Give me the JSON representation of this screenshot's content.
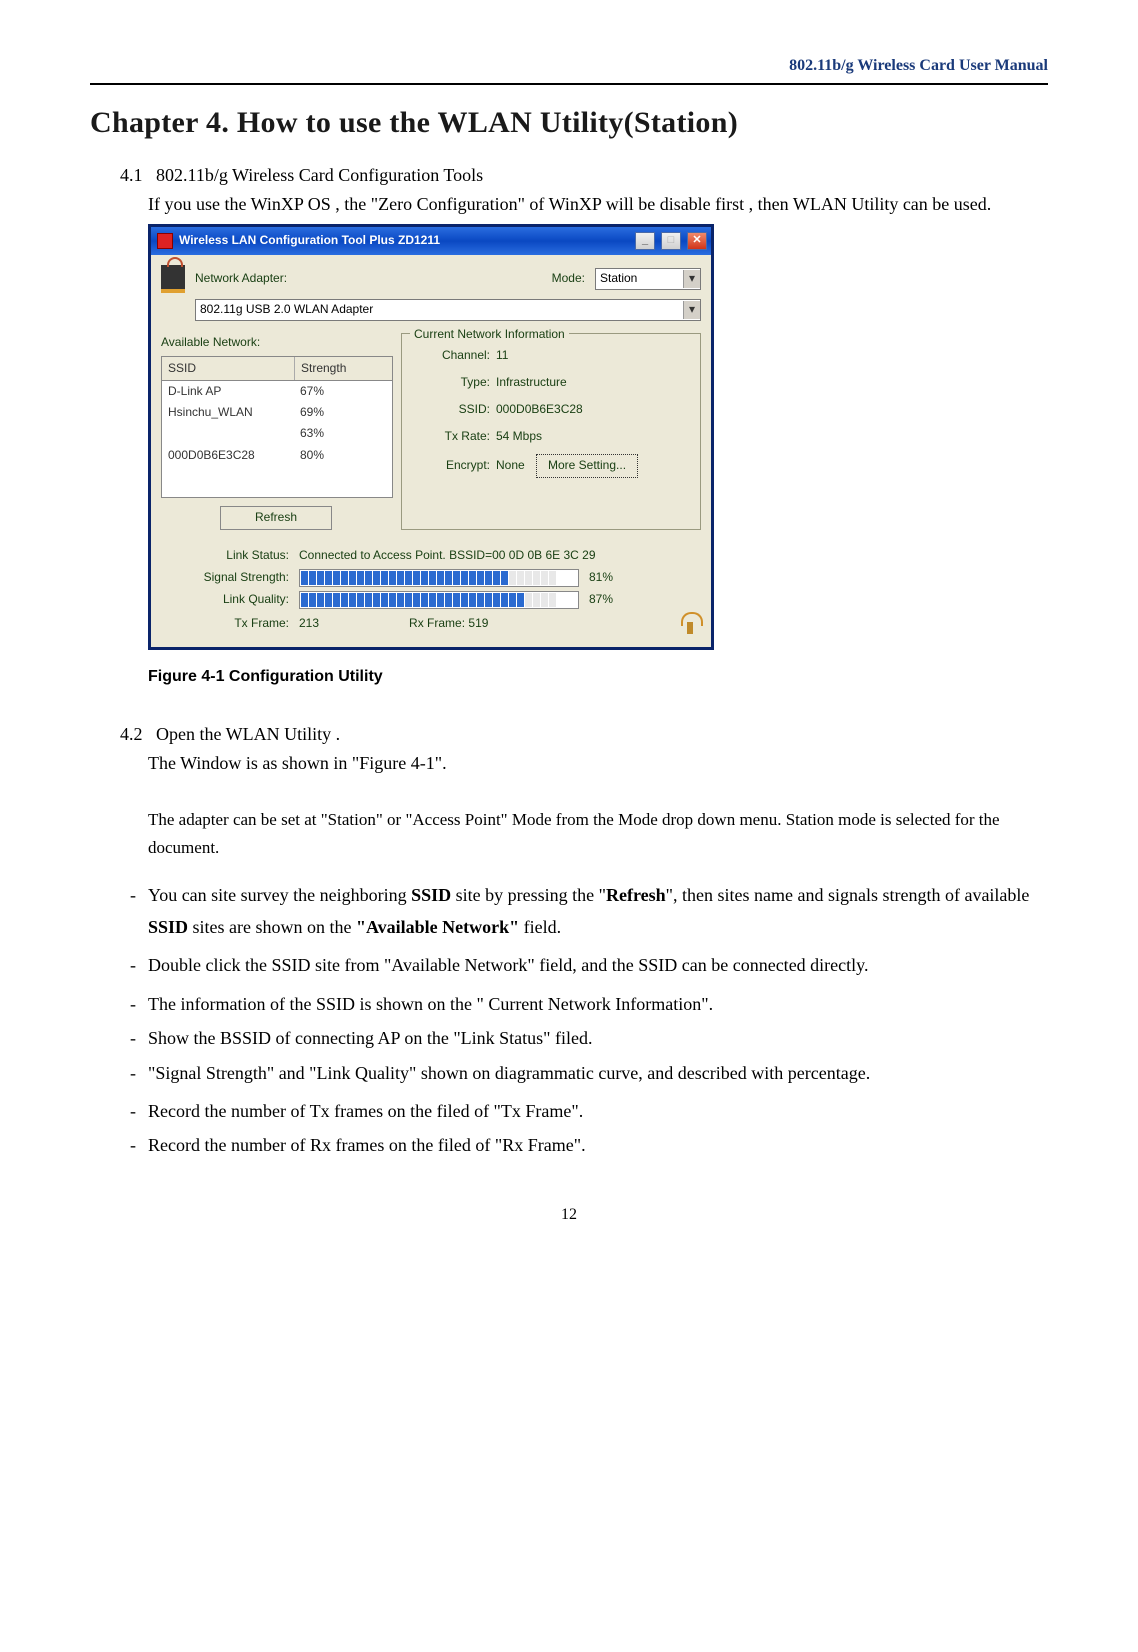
{
  "header": {
    "manual_title": "802.11b/g Wireless Card User Manual"
  },
  "chapter": {
    "title": "Chapter 4. How to use the WLAN Utility(Station)"
  },
  "sec41": {
    "num": "4.1",
    "title": "802.11b/g Wireless Card Configuration Tools",
    "para": "If you use the WinXP OS , the \"Zero Configuration\" of WinXP will be disable first , then WLAN Utility can be used."
  },
  "window": {
    "title": "Wireless LAN Configuration Tool Plus  ZD1211",
    "network_adapter_label": "Network Adapter:",
    "mode_label": "Mode:",
    "mode_value": "Station",
    "adapter_value": "802.11g USB 2.0 WLAN Adapter",
    "avail_label": "Available Network:",
    "cols": {
      "ssid": "SSID",
      "strength": "Strength"
    },
    "rows": [
      {
        "ssid": "D-Link AP",
        "strength": "67%"
      },
      {
        "ssid": "Hsinchu_WLAN",
        "strength": "69%"
      },
      {
        "ssid": "",
        "strength": "63%"
      },
      {
        "ssid": "000D0B6E3C28",
        "strength": "80%"
      }
    ],
    "refresh": "Refresh",
    "cni_label": "Current Network Information",
    "cni": {
      "channel_k": "Channel:",
      "channel_v": "11",
      "type_k": "Type:",
      "type_v": "Infrastructure",
      "ssid_k": "SSID:",
      "ssid_v": "000D0B6E3C28",
      "txrate_k": "Tx Rate:",
      "txrate_v": "54 Mbps",
      "encrypt_k": "Encrypt:",
      "encrypt_v": "None"
    },
    "more": "More Setting...",
    "status": {
      "link_status_k": "Link Status:",
      "link_status_v": "Connected to Access Point. BSSID=00 0D 0B 6E 3C 29",
      "sig_strength_k": "Signal Strength:",
      "sig_strength_pct": "81%",
      "link_quality_k": "Link Quality:",
      "link_quality_pct": "87%",
      "txframe_k": "Tx Frame:",
      "txframe_v": "213",
      "rxframe_k": "Rx Frame:",
      "rxframe_v": "519"
    }
  },
  "caption": "Figure 4-1 Configuration Utility",
  "sec42": {
    "num": "4.2",
    "title": "Open the WLAN Utility .",
    "line": "The Window is as shown in \"Figure 4-1\".",
    "adapter_note": "The adapter can be set at \"Station\" or \"Access Point\" Mode from the Mode drop down menu. Station mode is selected for the document."
  },
  "bullets": {
    "b1a": "You can site survey the neighboring ",
    "b1b_bold": "SSID",
    "b1c": " site by pressing the \"",
    "b1d_bold": "Refresh",
    "b1e": "\", then sites name and signals strength of available ",
    "b1f_bold": "SSID",
    "b1g": " sites are shown on the ",
    "b1h_bold": "\"Available Network\"",
    "b1i": " field.",
    "b2": "Double click the SSID site from \"Available Network\" field, and the SSID can be connected directly.",
    "b3": "The information of the SSID is shown on the \" Current Network Information\".",
    "b4": "Show the BSSID of connecting AP on the \"Link Status\" filed.",
    "b5": "\"Signal Strength\" and \"Link Quality\" shown on diagrammatic curve, and described with percentage.",
    "b6": "Record the number of Tx frames on the filed of \"Tx Frame\".",
    "b7": "Record the number of Rx frames on the filed of \"Rx Frame\"."
  },
  "page_number": "12"
}
